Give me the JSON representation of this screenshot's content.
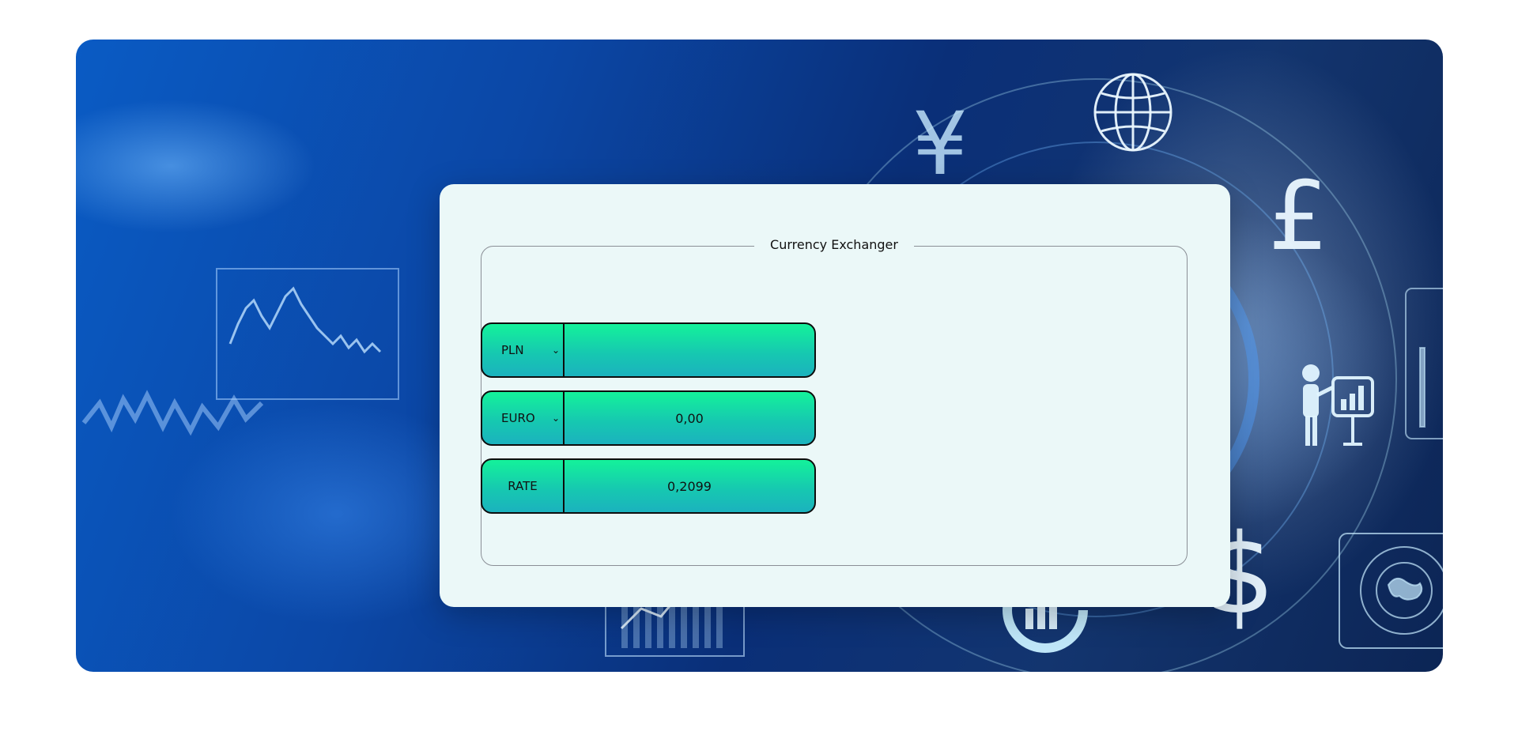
{
  "panel": {
    "legend": "Currency Exchanger"
  },
  "converter": {
    "from": {
      "currency": "PLN",
      "amount": ""
    },
    "to": {
      "currency": "EURO",
      "amount": "0,00"
    },
    "rate": {
      "label": "RATE",
      "value": "0,2099"
    }
  },
  "icons": {
    "select_chevron": "chevron-down-icon",
    "background": [
      "globe-icon",
      "pound-icon",
      "dollar-icon",
      "yen-icon",
      "presenter-chart-icon",
      "donut-chart-icon",
      "world-map-icon",
      "candlestick-chart-icon",
      "bar-chart-icon"
    ]
  },
  "colors": {
    "page_bg": "#ffffff",
    "card_bg": "#ebf8f8",
    "row_gradient_top": "#14f29a",
    "row_gradient_bottom": "#1bb2be",
    "border": "#0d0d0d",
    "hero_dark": "#0a2f78",
    "hero_light": "#0a5bc4"
  }
}
